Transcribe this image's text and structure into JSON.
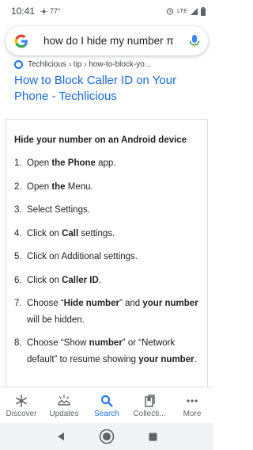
{
  "status_bar": {
    "time": "10:41",
    "temperature": "77°",
    "network": "LTE"
  },
  "search": {
    "query": "how do I hide my number π"
  },
  "result": {
    "breadcrumb": "Techlicious › tip › how-to-block-yo...",
    "title": "How to Block Caller ID on Your Phone - Techlicious"
  },
  "card": {
    "heading": "Hide your number on an Android device",
    "steps": [
      {
        "num": "1.",
        "parts": [
          "Open ",
          "the Phone",
          " app."
        ]
      },
      {
        "num": "2.",
        "parts": [
          "Open ",
          "the",
          " Menu."
        ]
      },
      {
        "num": "3.",
        "parts": [
          "Select Settings.",
          "",
          ""
        ]
      },
      {
        "num": "4.",
        "parts": [
          "Click on ",
          "Call",
          " settings."
        ]
      },
      {
        "num": "5.",
        "parts": [
          "Click on Additional settings.",
          "",
          ""
        ]
      },
      {
        "num": "6.",
        "parts": [
          "Click on ",
          "Caller ID",
          "."
        ]
      },
      {
        "num": "7.",
        "parts": [
          "Choose “",
          "Hide number",
          "” and "
        ],
        "extra": [
          "your number",
          " will be hidden."
        ]
      },
      {
        "num": "8.",
        "parts": [
          "Choose “Show ",
          "number",
          "” or “Network default” to resume showing "
        ],
        "extra": [
          "your number",
          "."
        ]
      }
    ]
  },
  "bottom_nav": {
    "items": [
      {
        "label": "Discover",
        "icon": "asterisk-icon"
      },
      {
        "label": "Updates",
        "icon": "updates-icon"
      },
      {
        "label": "Search",
        "icon": "search-icon"
      },
      {
        "label": "Collecti...",
        "icon": "collections-icon"
      },
      {
        "label": "More",
        "icon": "more-icon"
      }
    ]
  },
  "colors": {
    "accent": "#1a73e8",
    "link": "#1967d2"
  }
}
